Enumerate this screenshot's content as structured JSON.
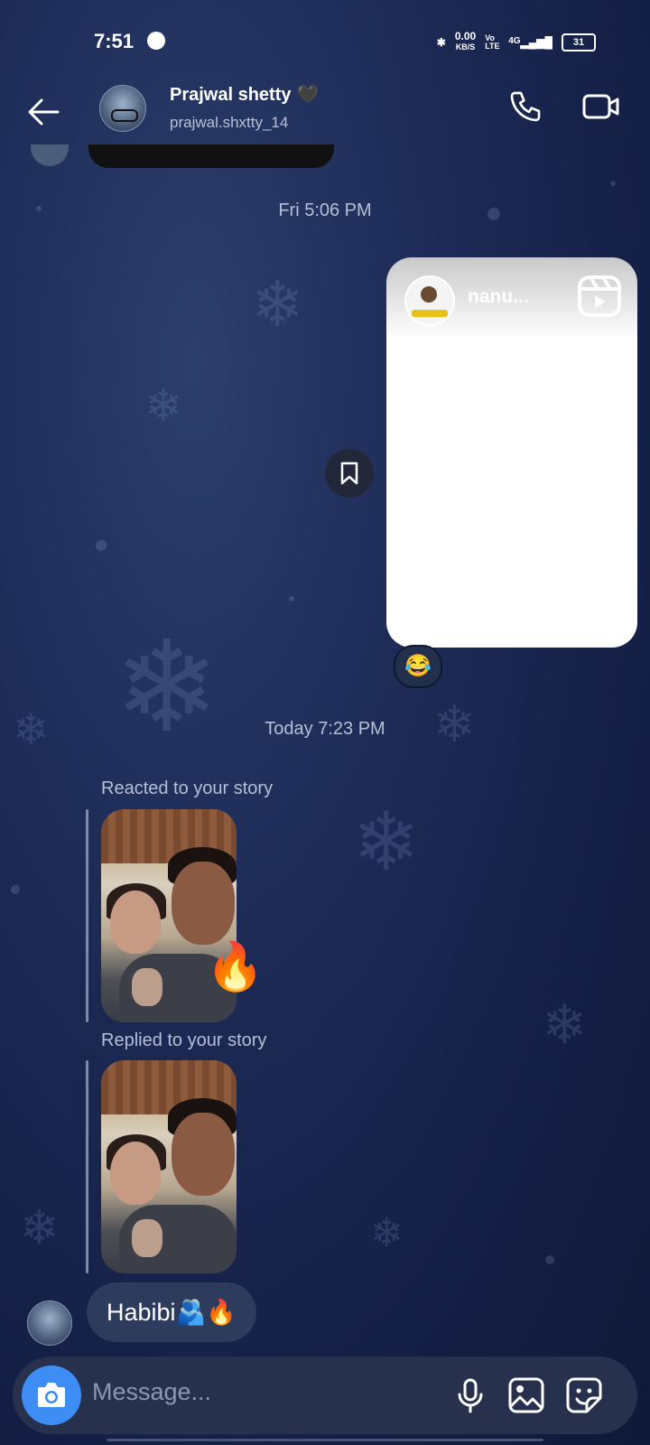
{
  "status_bar": {
    "time": "7:51",
    "net_speed": "0.00",
    "net_unit": "KB/S",
    "volte": "Vo LTE",
    "network": "4G",
    "battery": "31"
  },
  "header": {
    "contact_name": "Prajwal shetty 🖤",
    "username": "prajwal.shxtty_14"
  },
  "messages": {
    "stamp_fri": "Fri 5:06 PM",
    "reel_author": "nanu...",
    "reel_reaction": "😂",
    "stamp_today": "Today 7:23 PM",
    "reacted_label": "Reacted to your story",
    "story_reaction": "🔥",
    "replied_label": "Replied to your story",
    "reply_text": "Habibi🫂🔥"
  },
  "composer": {
    "placeholder": "Message..."
  },
  "colors": {
    "background": "#1c2a55",
    "accent": "#3d8df5",
    "bubble": "#2d3b5c"
  }
}
